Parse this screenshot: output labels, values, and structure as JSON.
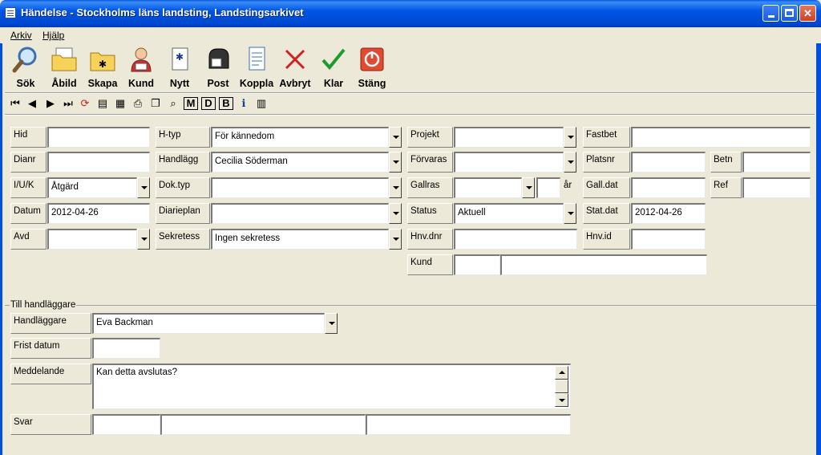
{
  "window": {
    "title": "Händelse - Stockholms läns landsting, Landstingsarkivet"
  },
  "menu": {
    "file": "Arkiv",
    "help": "Hjälp"
  },
  "toolbar": {
    "search": "Sök",
    "image": "Åbild",
    "create": "Skapa",
    "customer": "Kund",
    "new": "Nytt",
    "post": "Post",
    "link": "Koppla",
    "abort": "Avbryt",
    "done": "Klar",
    "close": "Stäng"
  },
  "smallbar": {
    "m": "M",
    "d": "D",
    "b": "B"
  },
  "form": {
    "hid": {
      "label": "Hid",
      "value": ""
    },
    "dianr": {
      "label": "Dianr",
      "value": ""
    },
    "iuk": {
      "label": "I/U/K",
      "value": "Åtgärd"
    },
    "datum": {
      "label": "Datum",
      "value": "2012-04-26"
    },
    "avd": {
      "label": "Avd",
      "value": ""
    },
    "htyp": {
      "label": "H-typ",
      "value": "För kännedom"
    },
    "handlagg": {
      "label": "Handlägg",
      "value": "Cecilia Söderman"
    },
    "doktyp": {
      "label": "Dok.typ",
      "value": ""
    },
    "diarieplan": {
      "label": "Diarieplan",
      "value": ""
    },
    "sekretess": {
      "label": "Sekretess",
      "value": "Ingen sekretess"
    },
    "projekt": {
      "label": "Projekt",
      "value": ""
    },
    "forvaras": {
      "label": "Förvaras",
      "value": ""
    },
    "gallras": {
      "label": "Gallras",
      "value": "",
      "years": "",
      "unit": "år"
    },
    "status": {
      "label": "Status",
      "value": "Aktuell"
    },
    "hnvdnr": {
      "label": "Hnv.dnr",
      "value": ""
    },
    "kund": {
      "label": "Kund",
      "value1": "",
      "value2": ""
    },
    "fastbet": {
      "label": "Fastbet",
      "value": ""
    },
    "platsnr": {
      "label": "Platsnr",
      "value": ""
    },
    "betn": {
      "label": "Betn",
      "value": ""
    },
    "galldat": {
      "label": "Gall.dat",
      "value": ""
    },
    "ref": {
      "label": "Ref",
      "value": ""
    },
    "statdat": {
      "label": "Stat.dat",
      "value": "2012-04-26"
    },
    "hnvid": {
      "label": "Hnv.id",
      "value": ""
    }
  },
  "handler": {
    "group_title": "Till handläggare",
    "handlaggare": {
      "label": "Handläggare",
      "value": "Eva Backman"
    },
    "frist": {
      "label": "Frist datum",
      "value": ""
    },
    "meddelande": {
      "label": "Meddelande",
      "value": "Kan detta avslutas?"
    },
    "svar": {
      "label": "Svar",
      "v1": "",
      "v2": "",
      "v3": ""
    }
  }
}
